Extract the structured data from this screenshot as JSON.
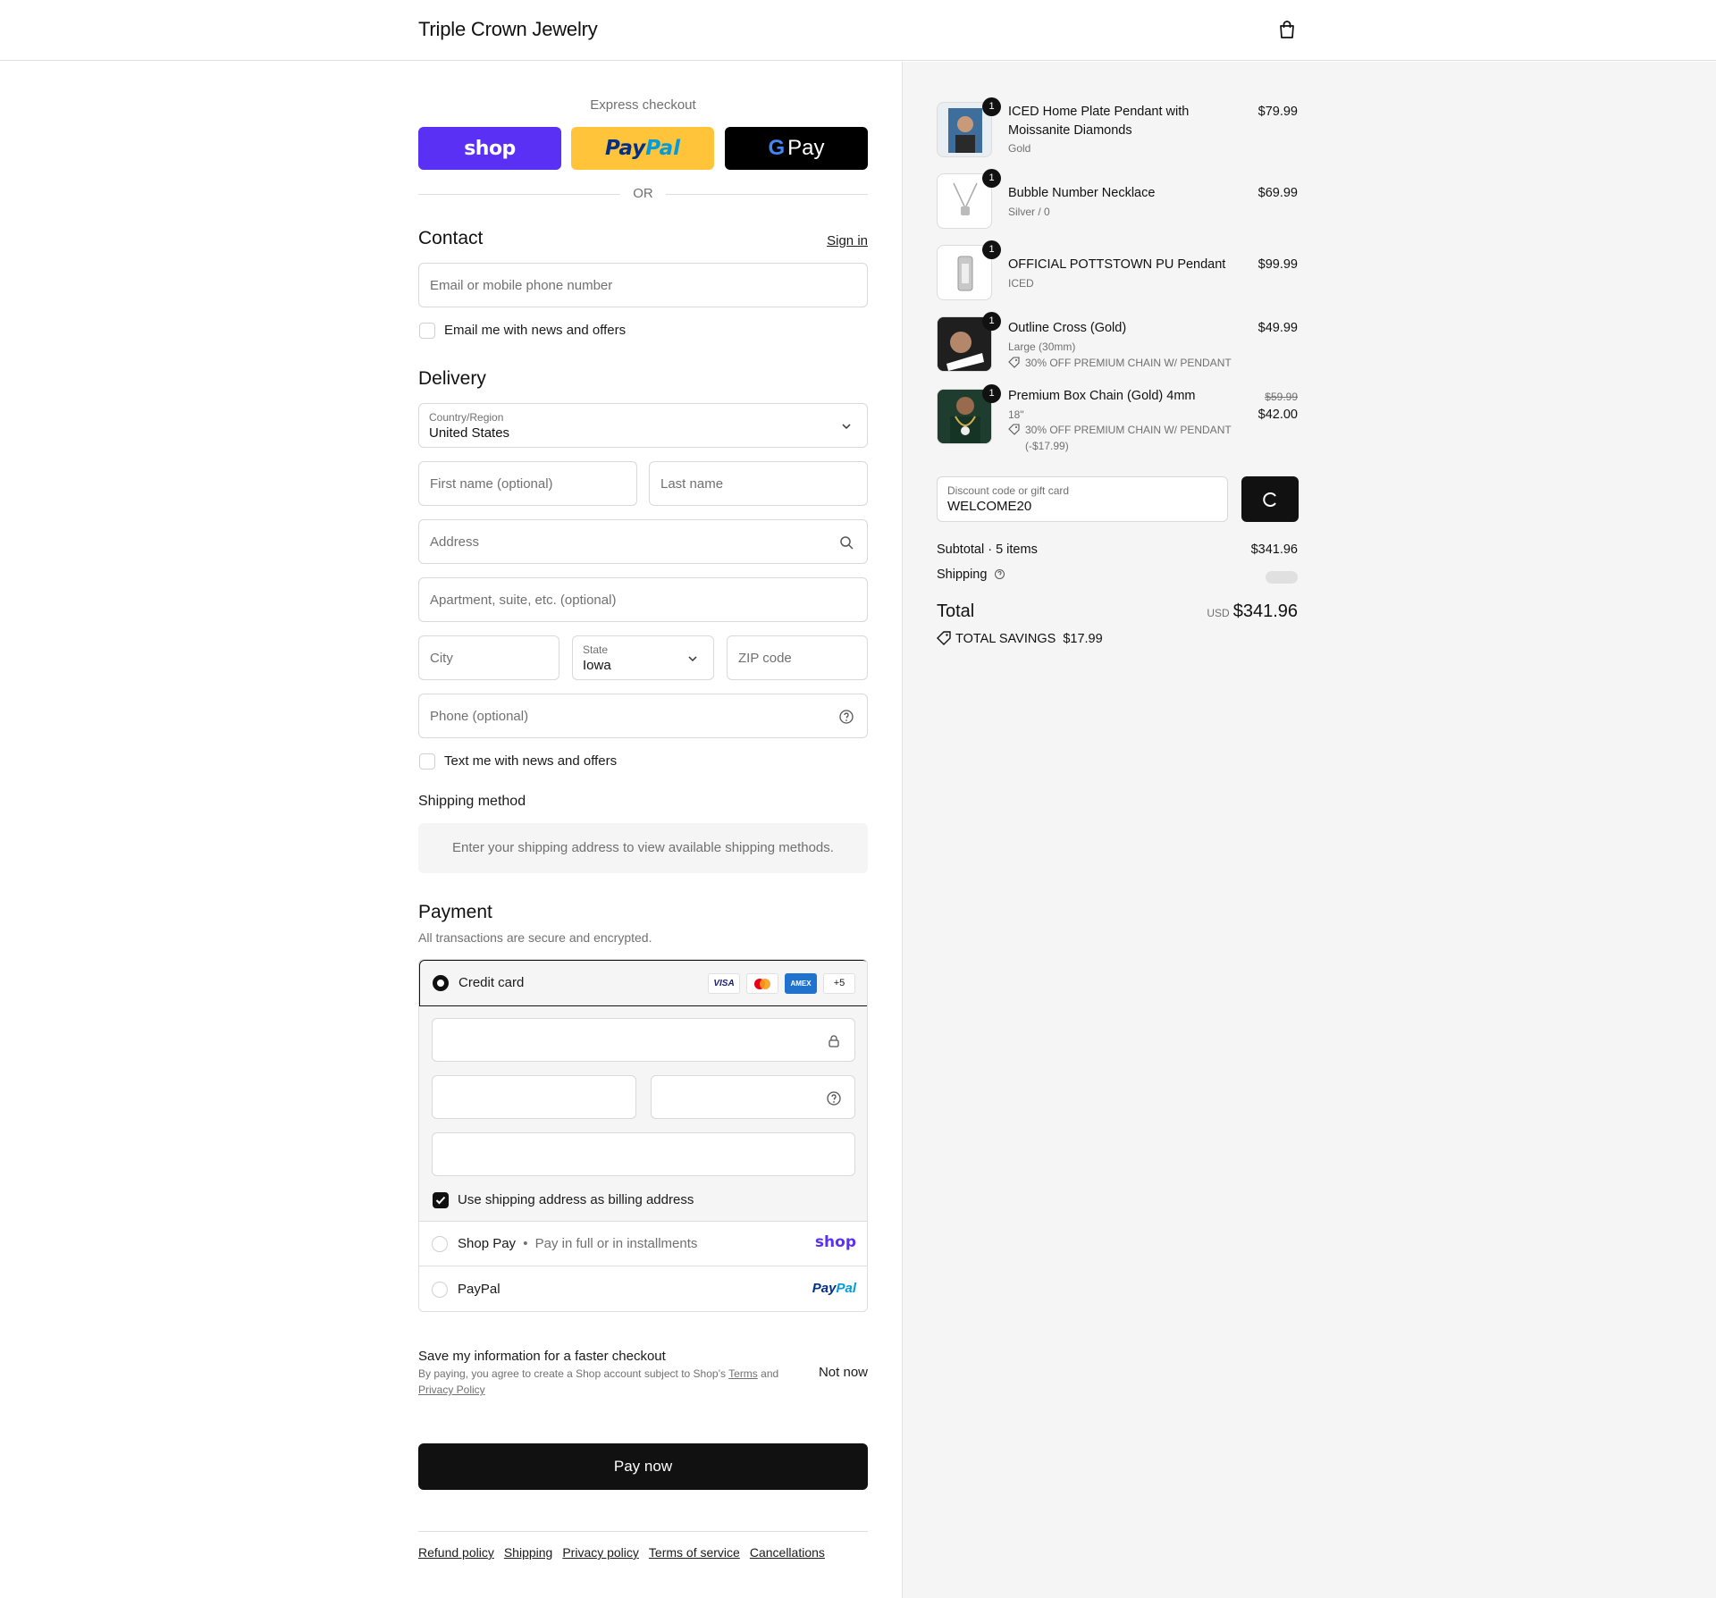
{
  "header": {
    "brand": "Triple Crown Jewelry",
    "cart_icon": "shopping-bag-icon"
  },
  "express": {
    "title": "Express checkout",
    "shop_label": "shop",
    "paypal_a": "Pay",
    "paypal_b": "Pal",
    "gpay_g": "G",
    "gpay_label": "Pay",
    "or": "OR"
  },
  "contact": {
    "heading": "Contact",
    "sign_in": "Sign in",
    "email_placeholder": "Email or mobile phone number",
    "news_label": "Email me with news and offers"
  },
  "delivery": {
    "heading": "Delivery",
    "country_label": "Country/Region",
    "country_value": "United States",
    "first_name_placeholder": "First name (optional)",
    "last_name_placeholder": "Last name",
    "address_placeholder": "Address",
    "apartment_placeholder": "Apartment, suite, etc. (optional)",
    "city_placeholder": "City",
    "state_label": "State",
    "state_value": "Iowa",
    "zip_placeholder": "ZIP code",
    "phone_placeholder": "Phone (optional)",
    "text_label": "Text me with news and offers"
  },
  "shipping_method": {
    "heading": "Shipping method",
    "message": "Enter your shipping address to view available shipping methods."
  },
  "payment": {
    "heading": "Payment",
    "subtitle": "All transactions are secure and encrypted.",
    "credit_card_label": "Credit card",
    "card_logos": [
      "VISA",
      "Mastercard",
      "AMEX"
    ],
    "more_cards": "+5",
    "billing_label": "Use shipping address as billing address",
    "shop_pay_label": "Shop Pay",
    "shop_pay_sub": "Pay in full or in installments",
    "shop_pay_logo": "shop",
    "paypal_label": "PayPal",
    "paypal_logo_a": "Pay",
    "paypal_logo_b": "Pal"
  },
  "save_info": {
    "title": "Save my information for a faster checkout",
    "text_before": "By paying, you agree to create a Shop account subject to Shop’s",
    "terms": "Terms",
    "and": "and",
    "privacy": "Privacy Policy",
    "not_now": "Not now"
  },
  "pay_now": "Pay now",
  "footer": [
    "Refund policy",
    "Shipping",
    "Privacy policy",
    "Terms of service",
    "Cancellations"
  ],
  "order": {
    "items": [
      {
        "qty": "1",
        "name": "ICED Home Plate Pendant with Moissanite Diamonds",
        "variant": "Gold",
        "price": "$79.99"
      },
      {
        "qty": "1",
        "name": "Bubble Number Necklace",
        "variant": "Silver / 0",
        "price": "$69.99"
      },
      {
        "qty": "1",
        "name": "OFFICIAL POTTSTOWN PU Pendant",
        "variant": "ICED",
        "price": "$99.99"
      },
      {
        "qty": "1",
        "name": "Outline Cross (Gold)",
        "variant": "Large (30mm)",
        "discount": "30% OFF PREMIUM CHAIN W/ PENDANT",
        "price": "$49.99"
      },
      {
        "qty": "1",
        "name": "Premium Box Chain (Gold) 4mm",
        "variant": "18\"",
        "discount": "30% OFF PREMIUM CHAIN W/ PENDANT",
        "discount_amount": "(-$17.99)",
        "original_price": "$59.99",
        "price": "$42.00"
      }
    ],
    "discount_label": "Discount code or gift card",
    "discount_value": "WELCOME20",
    "subtotal_label": "Subtotal · 5 items",
    "subtotal_value": "$341.96",
    "shipping_label": "Shipping",
    "total_label": "Total",
    "currency": "USD",
    "total_value": "$341.96",
    "savings_label": "TOTAL SAVINGS",
    "savings_value": "$17.99"
  }
}
